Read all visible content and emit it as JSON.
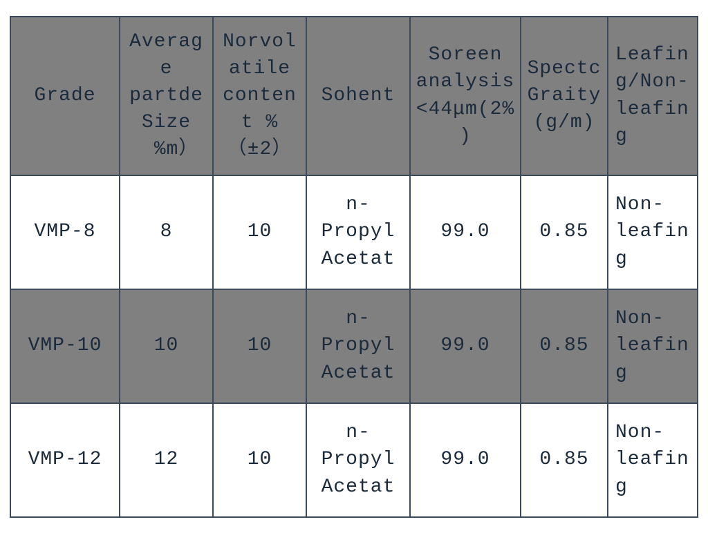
{
  "chart_data": {
    "type": "table",
    "headers": [
      "Grade",
      "Average partde Size\n　%m）",
      "Norvolatile content %\n（±2）",
      "Sohent",
      "Soreen analysis <44μm(2%)",
      "SpectcGraity (g/m)",
      "Leafing/Non-leafing"
    ],
    "rows": [
      {
        "grade": "VMP-8",
        "size": "8",
        "nonvol": "10",
        "sohent": "n-Propyl Acetat",
        "screen": "99.0",
        "gravity": "0.85",
        "leafing": "Non-leafing"
      },
      {
        "grade": "VMP-10",
        "size": "10",
        "nonvol": "10",
        "sohent": "n-Propyl Acetat",
        "screen": "99.0",
        "gravity": "0.85",
        "leafing": "Non-leafing"
      },
      {
        "grade": "VMP-12",
        "size": "12",
        "nonvol": "10",
        "sohent": "n-Propyl Acetat",
        "screen": "99.0",
        "gravity": "0.85",
        "leafing": "Non-leafing"
      }
    ]
  }
}
